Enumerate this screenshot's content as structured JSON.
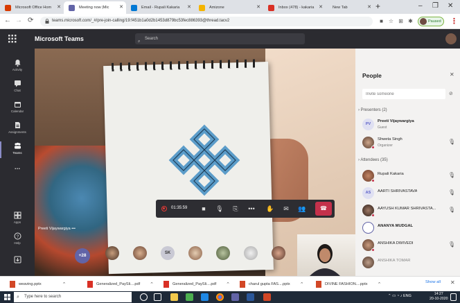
{
  "browser": {
    "tabs": [
      {
        "label": "Microsoft Office Hom",
        "color": "#d83b01"
      },
      {
        "label": "Meeting now |Mic",
        "color": "#6264a7",
        "active": true
      },
      {
        "label": "Email - Rupali Kakaria",
        "color": "#0078d4"
      },
      {
        "label": "Amizone",
        "color": "#f4b400"
      },
      {
        "label": "Inbox (478) - kakaria",
        "color": "#d93025"
      },
      {
        "label": "New Tab",
        "color": "#999999"
      }
    ],
    "url": "teams.microsoft.com/_#/pre-join-calling/19:f451b1a0d2b1453d879bc53fec886393@thread.tacv2",
    "paused_label": "Paused"
  },
  "teams": {
    "title": "Microsoft Teams",
    "search_placeholder": "Search",
    "rail": [
      {
        "label": "Activity",
        "icon": "bell-icon"
      },
      {
        "label": "Chat",
        "icon": "chat-icon"
      },
      {
        "label": "Calendar",
        "icon": "calendar-icon"
      },
      {
        "label": "Assignments",
        "icon": "assignments-icon"
      },
      {
        "label": "Teams",
        "icon": "teams-icon",
        "active": true
      },
      {
        "label": "...",
        "icon": "more-icon"
      },
      {
        "label": "Apps",
        "icon": "apps-icon"
      },
      {
        "label": "Help",
        "icon": "help-icon"
      }
    ]
  },
  "call": {
    "timer": "01:35:59",
    "presenter_label": "Preeti Vijaywargiya",
    "more_count": "+28",
    "roster_initials": "SK"
  },
  "people": {
    "title": "People",
    "invite_placeholder": "Invite someone",
    "presenters_heading": "Presenters (2)",
    "presenters": [
      {
        "name": "Preeti Vijaywargiya",
        "role": "Guest",
        "initials": "PV"
      },
      {
        "name": "Shweta Singh",
        "role": "Organizer"
      }
    ],
    "attendees_heading": "Attendees (35)",
    "attendees": [
      {
        "name": "Rupali Kakaria"
      },
      {
        "name": "AARTI SHRIVASTAVA",
        "initials": "AS"
      },
      {
        "name": "AAYUSH KUMAR SHRIVASTA..."
      },
      {
        "name": "ANANYA MUDGAL"
      },
      {
        "name": "ANSHIKA DWIVEDI"
      },
      {
        "name": "ANSHIKA TOMAR"
      }
    ]
  },
  "downloads": {
    "items": [
      {
        "label": "weaving.pptx",
        "color": "#d24726"
      },
      {
        "label": "Generalized_PaySli....pdf",
        "color": "#d93025"
      },
      {
        "label": "Generalized_PaySli....pdf",
        "color": "#d93025"
      },
      {
        "label": "charul gupta FAS....pptx",
        "color": "#d24726"
      },
      {
        "label": "DIVINE FASHION....pptx",
        "color": "#d24726"
      }
    ],
    "show_all": "Show all"
  },
  "taskbar": {
    "search_placeholder": "Type here to search",
    "tray_lang": "ENG",
    "time": "14:27",
    "date": "20-10-2020"
  }
}
